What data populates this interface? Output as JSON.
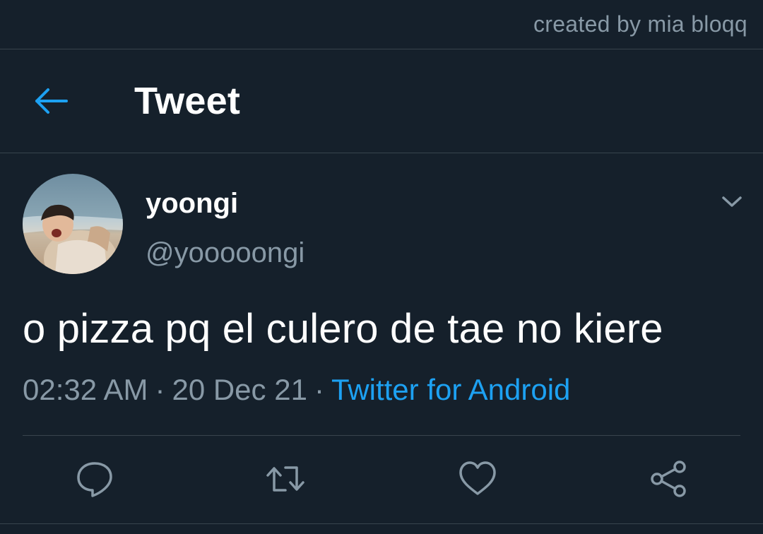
{
  "watermark": "created by mia bloqq",
  "header": {
    "title": "Tweet",
    "back_icon": "arrow-left-icon",
    "accent": "#1da1f2"
  },
  "tweet": {
    "author": {
      "name": "yoongi",
      "handle": "@yooooongi",
      "avatar": "profile-photo"
    },
    "text": "o pizza pq el culero de tae no kiere",
    "time": "02:32 AM",
    "date": "20 Dec 21",
    "separator": "·",
    "source": "Twitter for Android"
  },
  "actions": [
    {
      "name": "reply",
      "icon": "speech-bubble-icon"
    },
    {
      "name": "retweet",
      "icon": "retweet-icon"
    },
    {
      "name": "like",
      "icon": "heart-icon"
    },
    {
      "name": "share",
      "icon": "share-icon"
    }
  ],
  "colors": {
    "background": "#15202b",
    "divider": "#38444d",
    "muted": "#8899a6",
    "link": "#1da1f2"
  }
}
